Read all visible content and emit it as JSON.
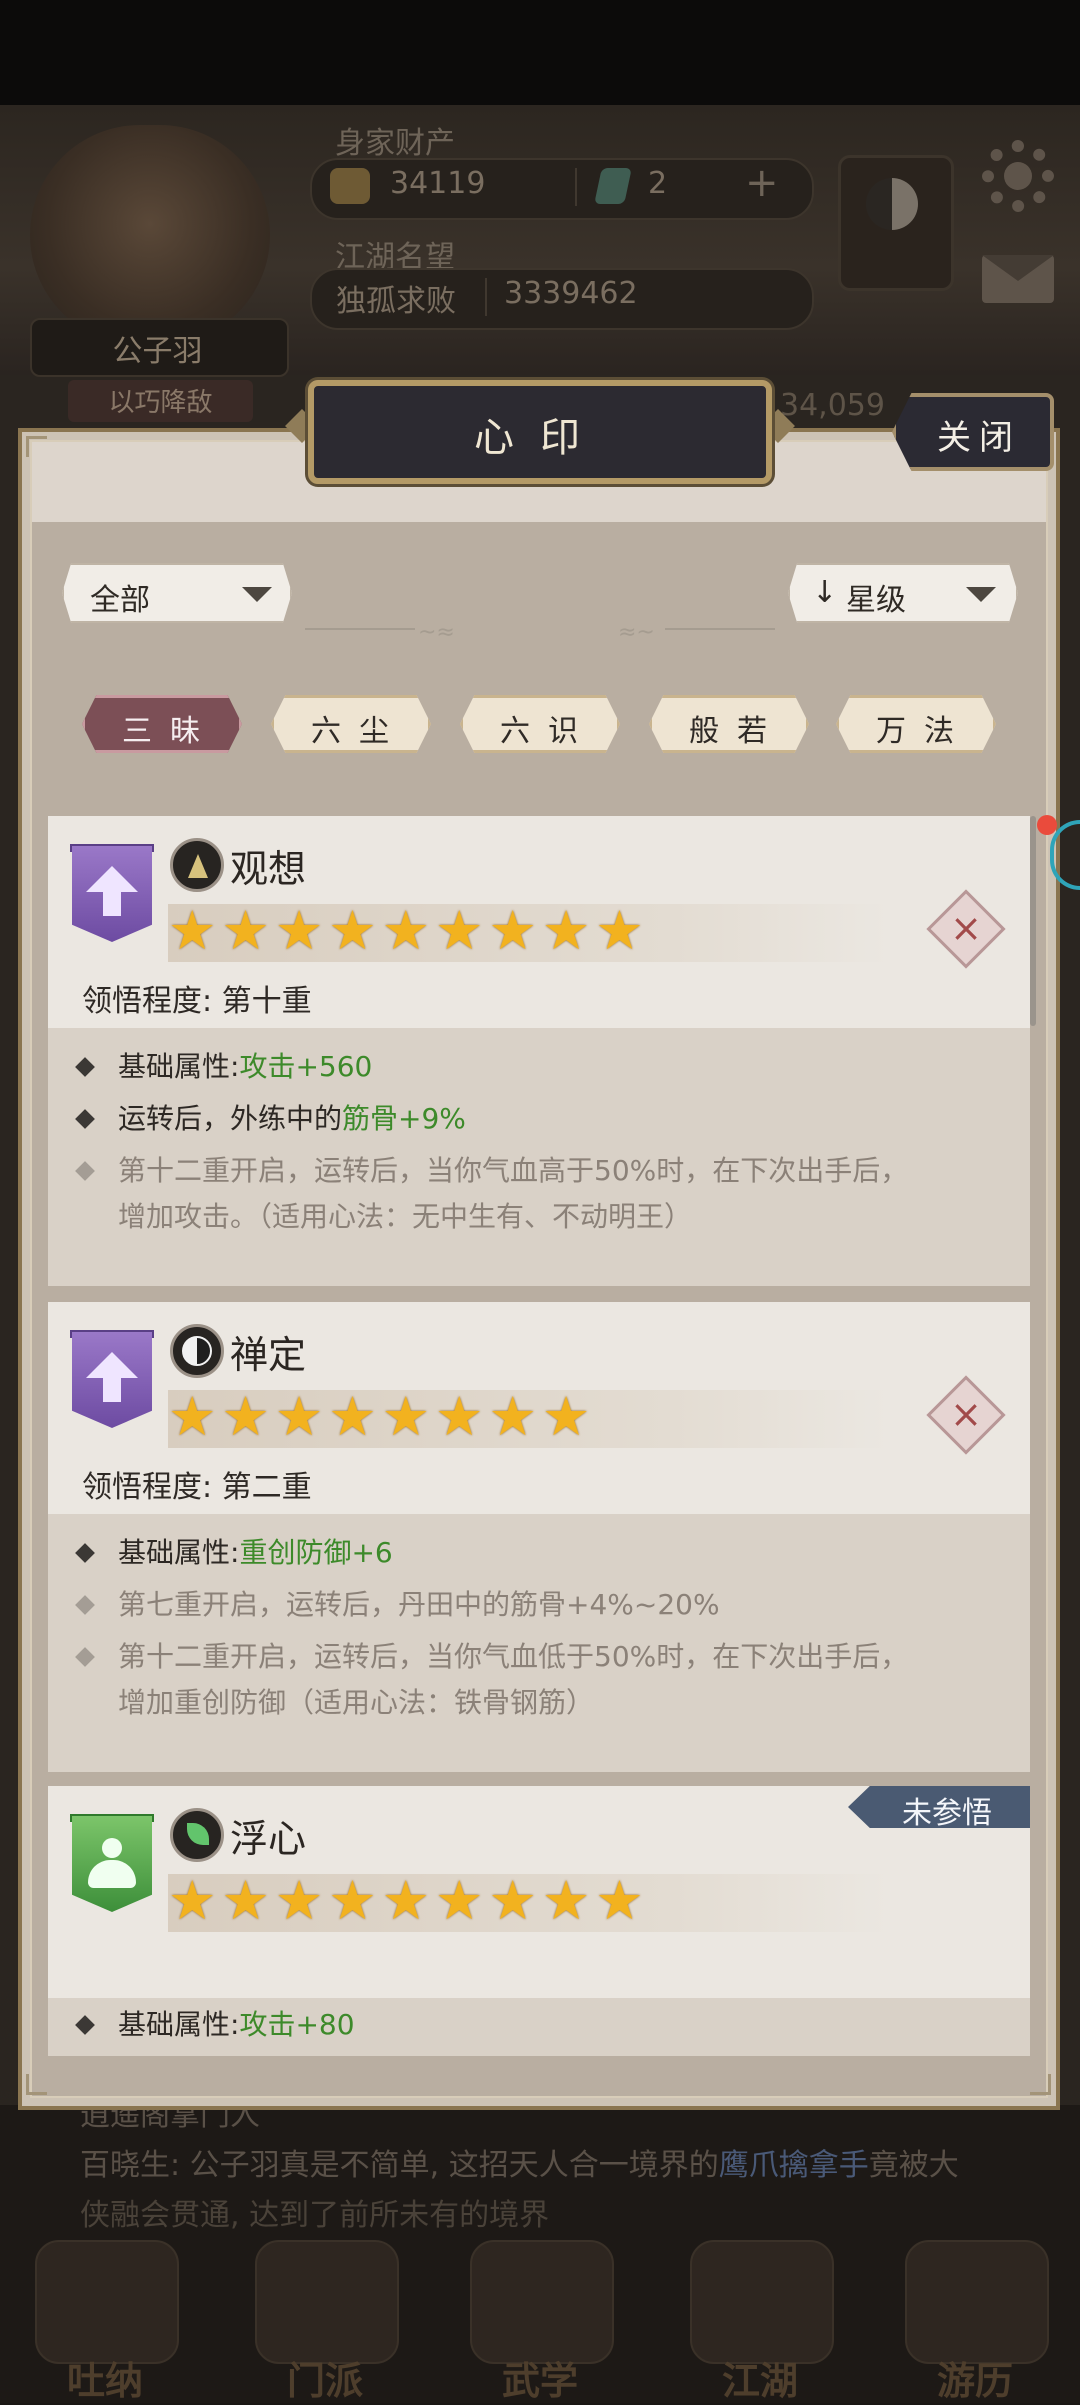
{
  "background": {
    "player_name": "公子羽",
    "player_title": "以巧降敌",
    "wealth_label": "身家财产",
    "coins": "34119",
    "gems": "2",
    "fame_label": "江湖名望",
    "fame_title": "独孤求败",
    "fame_value": "3339462",
    "power": "34,059",
    "chat_line1": "逍遥阁掌门人",
    "chat_line2_a": "百晓生: 公子羽真是不简单, 这招天人合一境界的",
    "chat_line2_b": "鹰爪擒拿手",
    "chat_line2_c": "竟被大",
    "chat_line3": "侠融会贯通, 达到了前所未有的境界",
    "nav": [
      "吐纳",
      "门派",
      "武学",
      "江湖",
      "游历"
    ]
  },
  "dialog": {
    "title": "心印",
    "close_label": "关闭"
  },
  "filters": {
    "type_value": "全部",
    "sort_value": "星级",
    "sort_arrow": "↓"
  },
  "categories": [
    {
      "label": "三昧",
      "active": true
    },
    {
      "label": "六尘",
      "active": false
    },
    {
      "label": "六识",
      "active": false
    },
    {
      "label": "般若",
      "active": false
    },
    {
      "label": "万法",
      "active": false
    }
  ],
  "cards": [
    {
      "name": "观想",
      "stars": 9,
      "stars_text": "★★★★★★★★★",
      "mastery_label": "领悟程度:",
      "mastery_value": "第十重",
      "rank_color": "#7a57b0",
      "attrs": [
        {
          "label": "基础属性:",
          "value": "攻击+560",
          "locked": false
        },
        {
          "label": "运转后，外练中的",
          "value": "筋骨+9%",
          "locked": false
        },
        {
          "label": "第十二重开启，运转后，当你气血高于50%时，在下次出手后，",
          "value": "",
          "locked": true
        },
        {
          "label": "增加攻击。（适用心法：无中生有、不动明王）",
          "value": "",
          "locked": true
        }
      ]
    },
    {
      "name": "禅定",
      "stars": 8,
      "stars_text": "★★★★★★★★",
      "mastery_label": "领悟程度:",
      "mastery_value": "第二重",
      "rank_color": "#7a57b0",
      "attrs": [
        {
          "label": "基础属性:",
          "value": "重创防御+6",
          "locked": false
        },
        {
          "label": "第七重开启，运转后，丹田中的筋骨+4%~20%",
          "value": "",
          "locked": true
        },
        {
          "label": "第十二重开启，运转后，当你气血低于50%时，在下次出手后，",
          "value": "",
          "locked": true
        },
        {
          "label": "增加重创防御（适用心法：铁骨钢筋）",
          "value": "",
          "locked": true
        }
      ]
    },
    {
      "name": "浮心",
      "stars": 9,
      "stars_text": "★★★★★★★★★",
      "status": "未参悟",
      "rank_color": "#4fa548",
      "attrs": [
        {
          "label": "基础属性:",
          "value": "攻击+80",
          "locked": false
        }
      ]
    }
  ]
}
